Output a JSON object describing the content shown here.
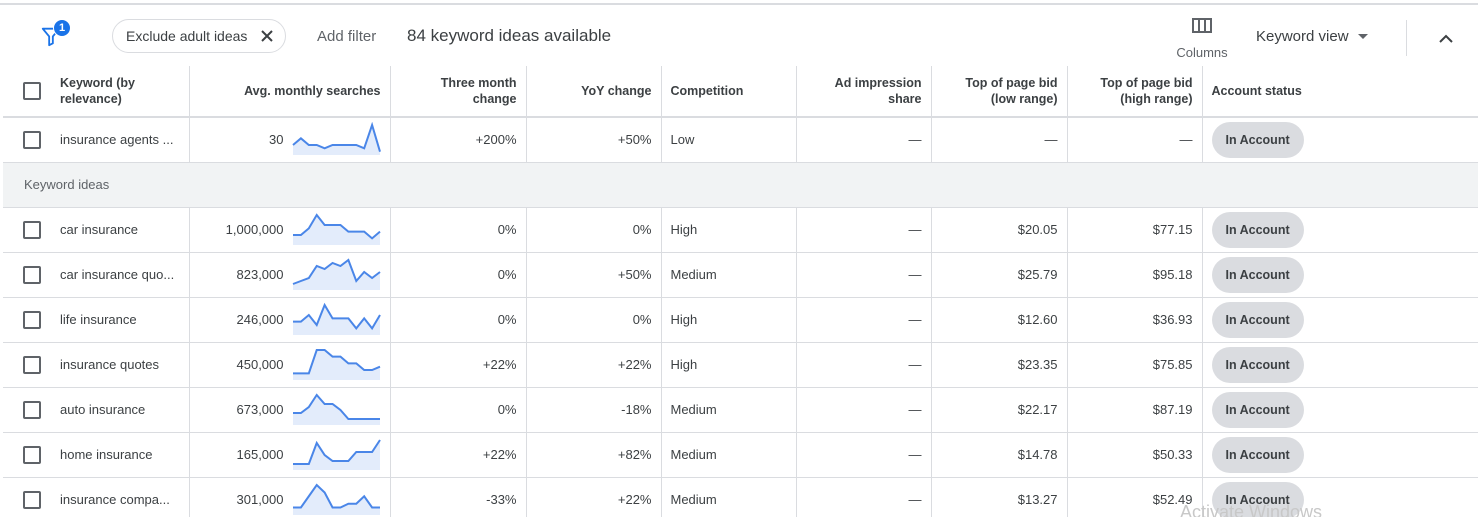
{
  "toolbar": {
    "filter_badge": "1",
    "chip_label": "Exclude adult ideas",
    "add_filter": "Add filter",
    "ideas_count": "84 keyword ideas available",
    "columns_label": "Columns",
    "view_label": "Keyword view"
  },
  "table": {
    "headers": {
      "keyword": "Keyword (by relevance)",
      "searches": "Avg. monthly searches",
      "three_month": "Three month change",
      "yoy": "YoY change",
      "competition": "Competition",
      "ad_share": "Ad impression share",
      "bid_low": "Top of page bid (low range)",
      "bid_high": "Top of page bid (high range)",
      "status": "Account status"
    },
    "provided": [
      {
        "keyword": "insurance agents ...",
        "searches": "30",
        "three_month": "+200%",
        "yoy": "+50%",
        "competition": "Low",
        "ad_share": "—",
        "bid_low": "—",
        "bid_high": "—",
        "status": "In Account",
        "trend": [
          3,
          5,
          3,
          3,
          2,
          3,
          3,
          3,
          3,
          2,
          9,
          1
        ]
      }
    ],
    "section_label": "Keyword ideas",
    "ideas": [
      {
        "keyword": "car insurance",
        "searches": "1,000,000",
        "three_month": "0%",
        "yoy": "0%",
        "competition": "High",
        "ad_share": "—",
        "bid_low": "$20.05",
        "bid_high": "$77.15",
        "status": "In Account",
        "trend": [
          3,
          3,
          5,
          9,
          6,
          6,
          6,
          4,
          4,
          4,
          2,
          4
        ]
      },
      {
        "keyword": "car insurance quo...",
        "searches": "823,000",
        "three_month": "0%",
        "yoy": "+50%",
        "competition": "Medium",
        "ad_share": "—",
        "bid_low": "$25.79",
        "bid_high": "$95.18",
        "status": "In Account",
        "trend": [
          2,
          3,
          4,
          8,
          7,
          9,
          8,
          10,
          3,
          6,
          4,
          6
        ]
      },
      {
        "keyword": "life insurance",
        "searches": "246,000",
        "three_month": "0%",
        "yoy": "0%",
        "competition": "High",
        "ad_share": "—",
        "bid_low": "$12.60",
        "bid_high": "$36.93",
        "status": "In Account",
        "trend": [
          4,
          4,
          6,
          3,
          9,
          5,
          5,
          5,
          2,
          5,
          2,
          6
        ]
      },
      {
        "keyword": "insurance quotes",
        "searches": "450,000",
        "three_month": "+22%",
        "yoy": "+22%",
        "competition": "High",
        "ad_share": "—",
        "bid_low": "$23.35",
        "bid_high": "$75.85",
        "status": "In Account",
        "trend": [
          2,
          2,
          2,
          9,
          9,
          7,
          7,
          5,
          5,
          3,
          3,
          4
        ]
      },
      {
        "keyword": "auto insurance",
        "searches": "673,000",
        "three_month": "0%",
        "yoy": "-18%",
        "competition": "Medium",
        "ad_share": "—",
        "bid_low": "$22.17",
        "bid_high": "$87.19",
        "status": "In Account",
        "trend": [
          4,
          4,
          6,
          10,
          7,
          7,
          5,
          2,
          2,
          2,
          2,
          2
        ]
      },
      {
        "keyword": "home insurance",
        "searches": "165,000",
        "three_month": "+22%",
        "yoy": "+82%",
        "competition": "Medium",
        "ad_share": "—",
        "bid_low": "$14.78",
        "bid_high": "$50.33",
        "status": "In Account",
        "trend": [
          2,
          2,
          2,
          9,
          5,
          3,
          3,
          3,
          6,
          6,
          6,
          10
        ]
      },
      {
        "keyword": "insurance compa...",
        "searches": "301,000",
        "three_month": "-33%",
        "yoy": "+22%",
        "competition": "Medium",
        "ad_share": "—",
        "bid_low": "$13.27",
        "bid_high": "$52.49",
        "status": "In Account",
        "trend": [
          2,
          2,
          5,
          8,
          6,
          2,
          2,
          3,
          3,
          5,
          2,
          2
        ]
      }
    ]
  },
  "colors": {
    "accent": "#1a73e8",
    "sparkline": "#4a86e8",
    "sparkline_fill": "#e3ecfb",
    "pill_bg": "#dadce0",
    "section_bg": "#f1f3f4"
  },
  "watermark": "Activate Windows"
}
